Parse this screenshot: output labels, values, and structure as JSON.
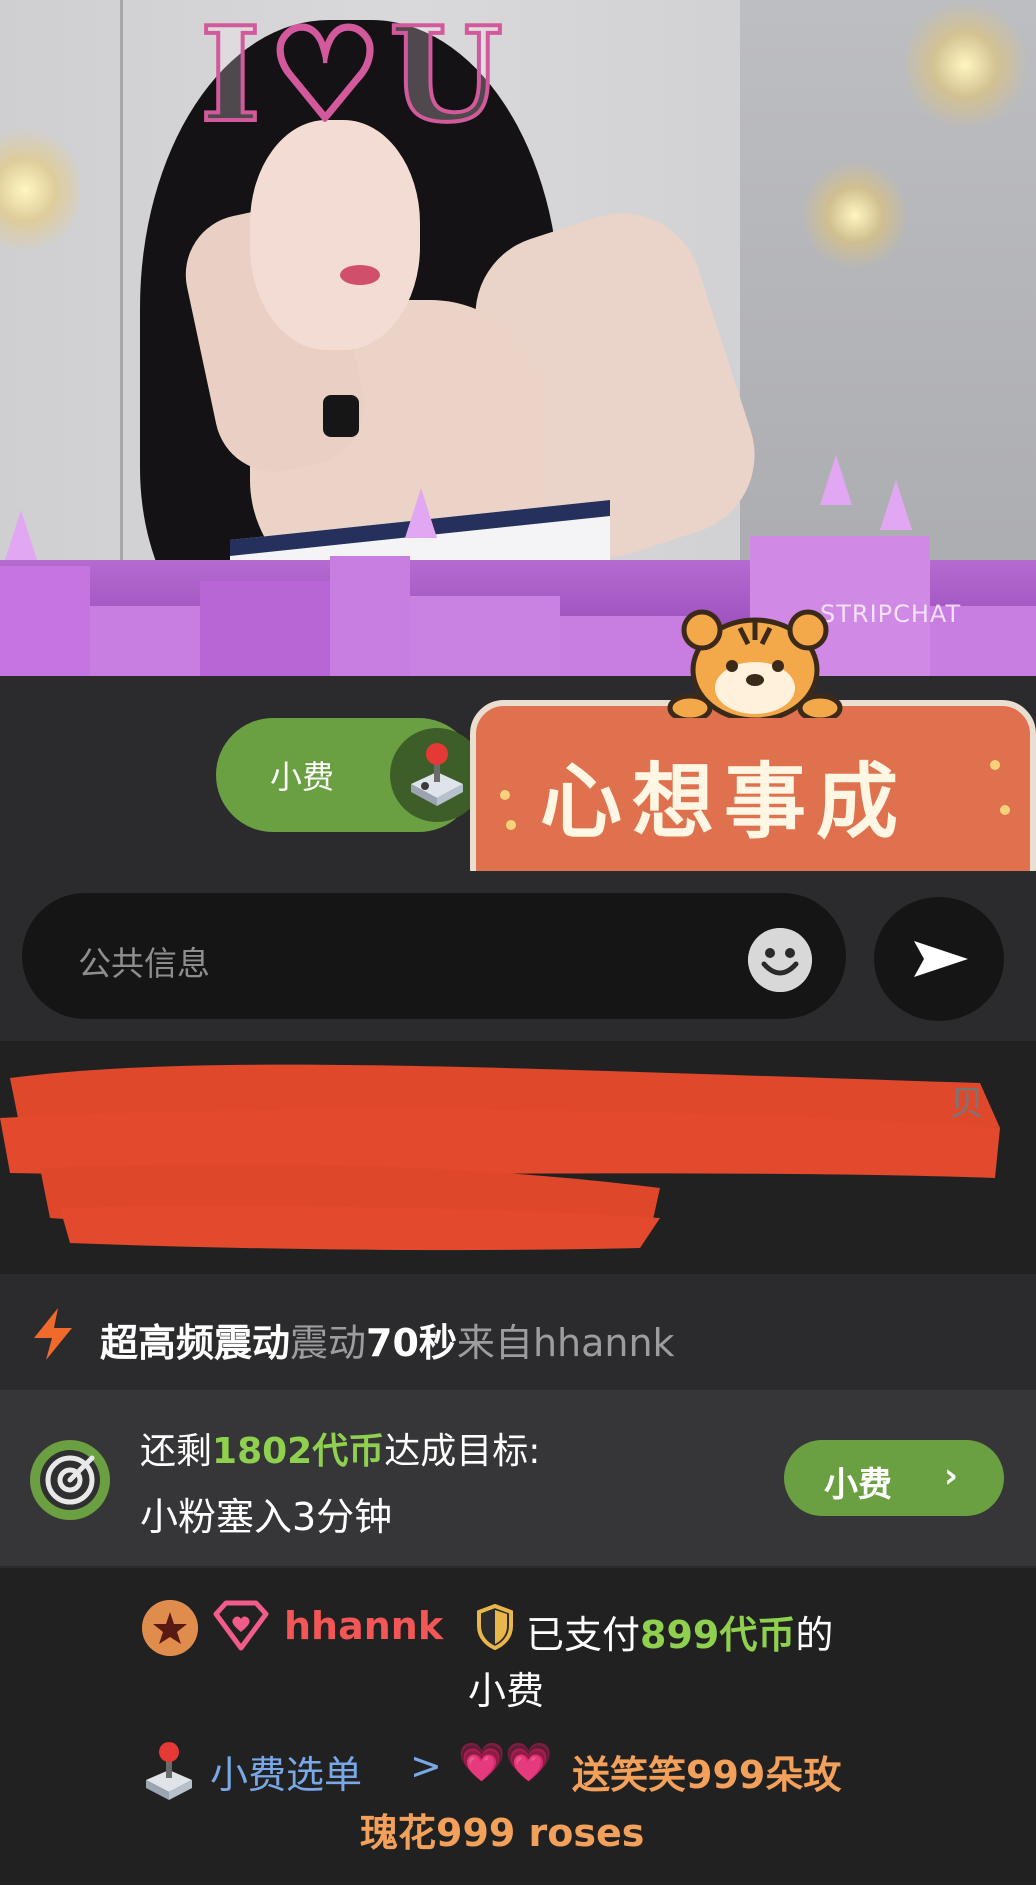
{
  "video": {
    "overlay_text": "I♡U",
    "watermark": "STRIPCHAT"
  },
  "tip_bar": {
    "tip_button_label": "小费",
    "joystick_icon": "joystick-icon"
  },
  "sticker": {
    "text": "心想事成",
    "mascot": "tiger-icon"
  },
  "message_input": {
    "placeholder": "公共信息",
    "emoji_icon": "smiley-icon",
    "send_icon": "send-arrow-icon"
  },
  "chat": {
    "vibration": {
      "level": "超高频震动",
      "action": "震动",
      "duration": "70秒",
      "from": "来自",
      "user": "hhannk"
    },
    "goal": {
      "prefix": "还剩",
      "amount": "1802代币",
      "suffix": "达成目标:",
      "description": "小粉塞入3分钟",
      "tip_button_label": "小费",
      "chevron": "›"
    },
    "tip_message": {
      "username": "hhannk",
      "paid_prefix": "已支付",
      "amount": "899代币",
      "paid_suffix": "的",
      "line2": "小费",
      "menu_label": "小费选单",
      "menu_chevron": ">",
      "hearts": "💗💗",
      "menu_item_line1": "送笑笑999朵玫",
      "menu_item_line2": "瑰花999 roses"
    }
  },
  "colors": {
    "accent_green": "#6aa041",
    "token_green": "#8fd14f",
    "username_red": "#f25656",
    "menu_blue": "#79a8e6",
    "menu_orange": "#f2a05a",
    "sticker_orange": "#e0714f"
  }
}
